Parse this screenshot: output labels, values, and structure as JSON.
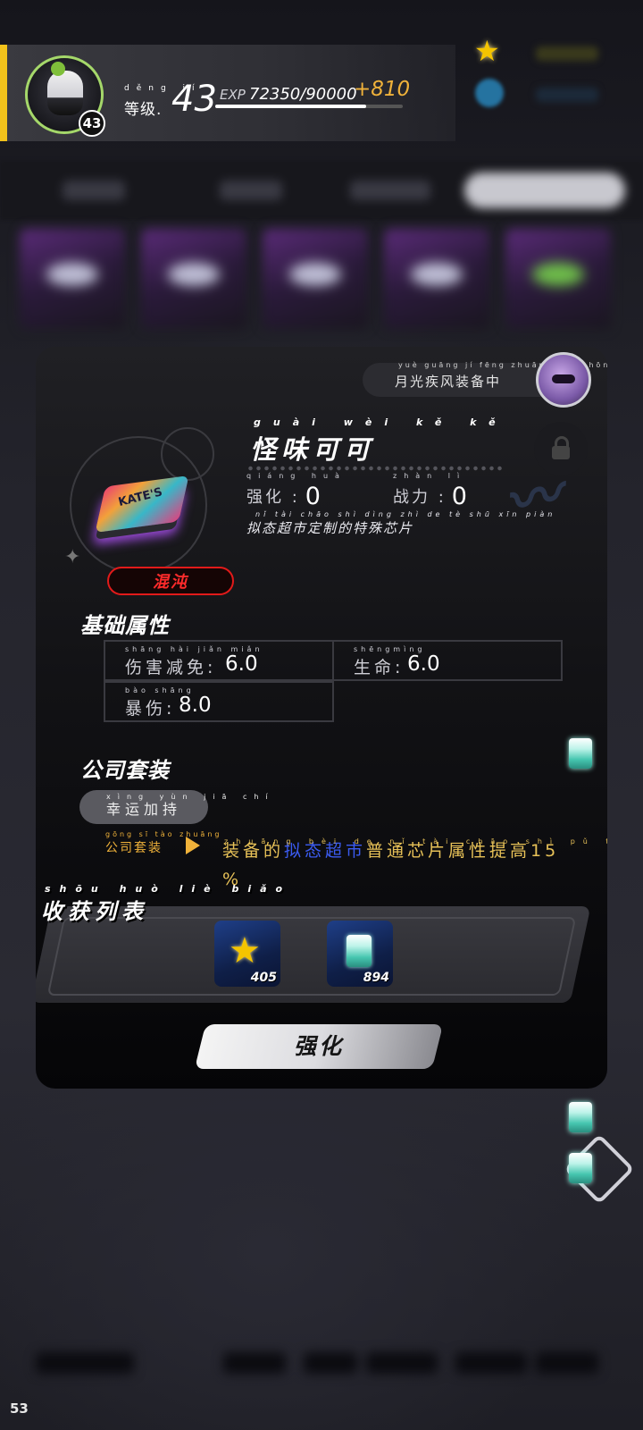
{
  "player": {
    "level_label": "等级.",
    "level_label_pinyin": "děng jí",
    "level": "43",
    "avatar_level_badge": "43",
    "exp_label": "EXP",
    "exp_value": "72350/90000",
    "exp_progress": 0.804,
    "exp_gain": "+810"
  },
  "currency": {
    "star_icon": "star-icon",
    "gem_icon": "gem-icon"
  },
  "equip_status": {
    "text": "月光疾风装备中",
    "pinyin": "yuè guāng jí fēng zhuāng bèi zhōng"
  },
  "item": {
    "name": "怪味可可",
    "name_pinyin": "guài wèi kě kě",
    "enhance_label": "强化 :",
    "enhance_pinyin": "qiáng huà",
    "enhance_value": "0",
    "power_label": "战力 :",
    "power_pinyin": "zhàn lì",
    "power_value": "0",
    "description": "拟态超市定制的特殊芯片",
    "description_pinyin": "nǐ tài chāo shì dìng zhì de tè shū xīn piàn",
    "rarity_tag": "混沌",
    "chip_art_text": "KATE'S"
  },
  "base_attributes": {
    "title": "基础属性",
    "items": [
      {
        "label": "伤害减免",
        "pinyin": "shāng hài jiǎn miǎn",
        "colon": ":",
        "value": "6.0"
      },
      {
        "label": "生命",
        "pinyin": "shēngmìng",
        "colon": ":",
        "value": "6.0"
      },
      {
        "label": "暴伤",
        "pinyin": "bào shāng",
        "colon": ":",
        "value": "8.0"
      }
    ]
  },
  "suit": {
    "title": "公司套装",
    "name": "幸运加持",
    "name_pinyin": "xìng yùn jiā chí",
    "tag": "公司套装",
    "tag_pinyin": "gōng sī tào zhuāng",
    "effect_part1": "装备的",
    "effect_blue": "拟态超市",
    "effect_part2": "普通芯片属性提高15",
    "effect_part3": "%",
    "effect_pinyin": "zhuāng bèi de nǐ tài chāo shì pǔ tōng xīn piàn shǔ xìng tí gāo"
  },
  "rewards": {
    "title": "收获列表",
    "title_pinyin": "shōu huò liè biǎo",
    "items": [
      {
        "icon": "star-icon",
        "count": "405"
      },
      {
        "icon": "cube-icon",
        "count": "894"
      }
    ]
  },
  "enhance_button": "强化",
  "fps": "53"
}
